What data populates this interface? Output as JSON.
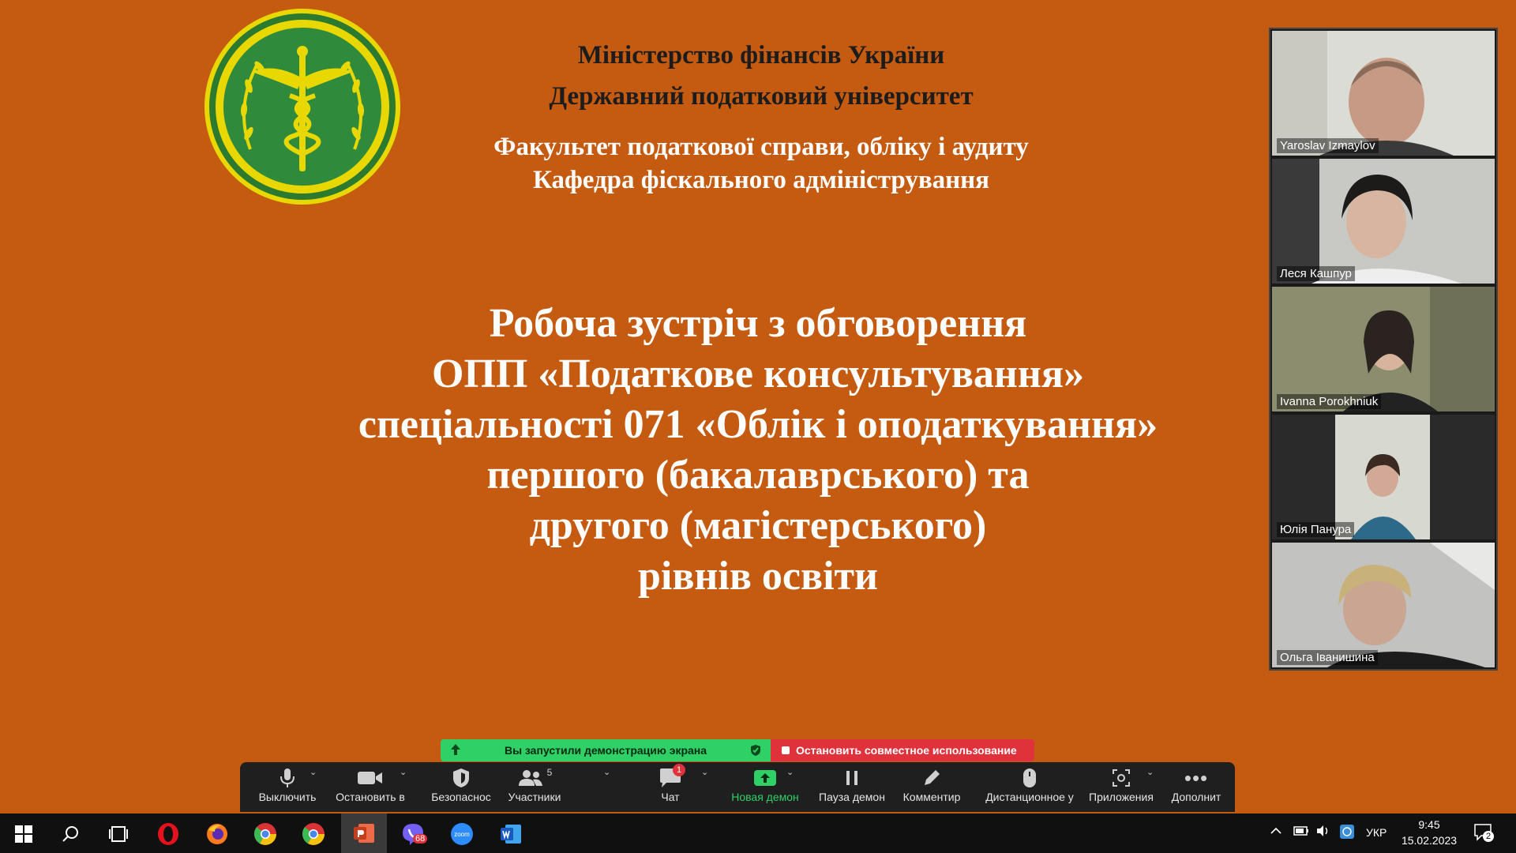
{
  "slide": {
    "ministry": "Міністерство фінансів України",
    "university": "Державний податковий університет",
    "faculty": "Факультет податкової справи, обліку і аудиту",
    "department": "Кафедра фіскального адміністрування",
    "title_lines": [
      "Робоча зустріч з обговорення",
      "ОПП «Податкове консультування»",
      "спеціальності 071 «Облік і оподаткування»",
      "першого (бакалаврського) та",
      "другого (магістерського)",
      "рівнів освіти"
    ],
    "colors": {
      "background": "#c55a11",
      "emblem_green": "#2f8a3c",
      "emblem_gold": "#e4d300"
    }
  },
  "participants": [
    {
      "name": "Yaroslav Izmaylov"
    },
    {
      "name": "Леся Кашпур"
    },
    {
      "name": "Ivanna Porokhniuk"
    },
    {
      "name": "Юлія Панура"
    },
    {
      "name": "Ольга Іванишина",
      "active_speaker": true
    }
  ],
  "share_banner": {
    "status": "Вы запустили демонстрацию экрана",
    "stop": "Остановить совместное использование"
  },
  "toolbar": {
    "mute": "Выключить",
    "video": "Остановить в",
    "security": "Безопаснос",
    "participants": "Участники",
    "participants_count": "5",
    "chat": "Чат",
    "chat_badge": "1",
    "new_share": "Новая демон",
    "pause_share": "Пауза демон",
    "annotate": "Комментир",
    "remote_control": "Дистанционное у",
    "apps": "Приложения",
    "more": "Дополнит"
  },
  "taskbar": {
    "viber_badge": "68",
    "language": "УКР",
    "time": "9:45",
    "date": "15.02.2023",
    "notifications": "2"
  }
}
